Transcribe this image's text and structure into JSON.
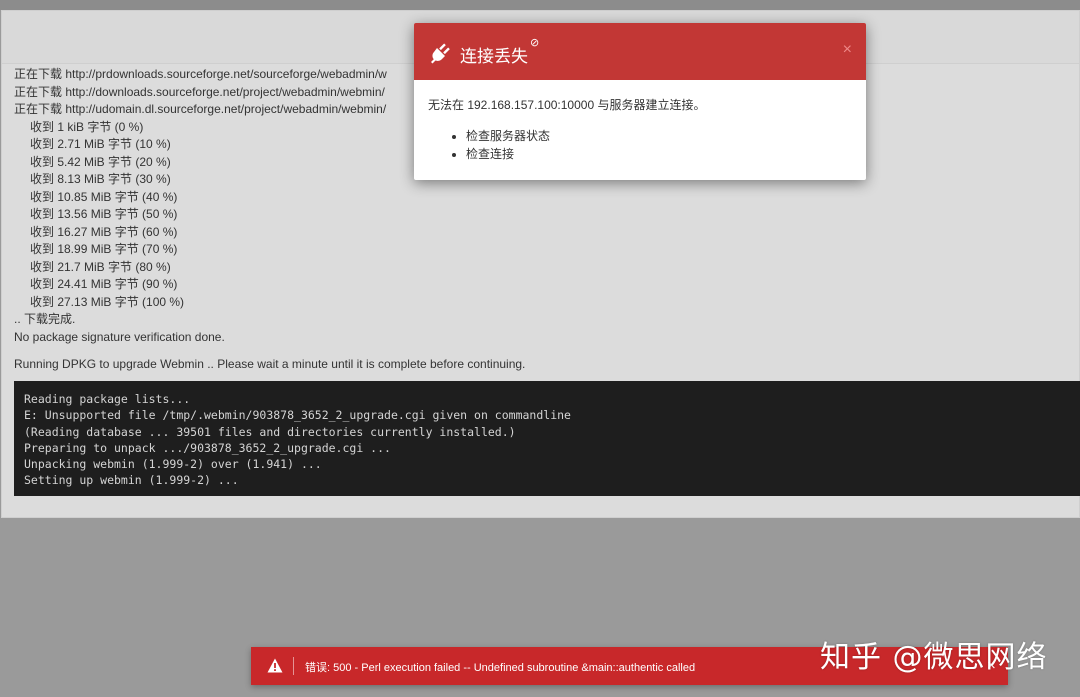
{
  "log": {
    "download_lines": [
      "正在下载 http://prdownloads.sourceforge.net/sourceforge/webadmin/w",
      "正在下载 http://downloads.sourceforge.net/project/webadmin/webmin/",
      "正在下载 http://udomain.dl.sourceforge.net/project/webadmin/webmin/"
    ],
    "progress_lines": [
      "收到 1 kiB 字节 (0 %)",
      "收到 2.71 MiB 字节 (10 %)",
      "收到 5.42 MiB 字节 (20 %)",
      "收到 8.13 MiB 字节 (30 %)",
      "收到 10.85 MiB 字节 (40 %)",
      "收到 13.56 MiB 字节 (50 %)",
      "收到 16.27 MiB 字节 (60 %)",
      "收到 18.99 MiB 字节 (70 %)",
      "收到 21.7 MiB 字节 (80 %)",
      "收到 24.41 MiB 字节 (90 %)",
      "收到 27.13 MiB 字节 (100 %)"
    ],
    "download_complete": ".. 下载完成.",
    "signature": "No package signature verification done.",
    "running": "Running DPKG to upgrade Webmin .. Please wait a minute until it is complete before continuing."
  },
  "terminal": {
    "lines": [
      "Reading package lists...",
      "E: Unsupported file /tmp/.webmin/903878_3652_2_upgrade.cgi given on commandline",
      "(Reading database ... 39501 files and directories currently installed.)",
      "Preparing to unpack .../903878_3652_2_upgrade.cgi ...",
      "Unpacking webmin (1.999-2) over (1.941) ...",
      "Setting up webmin (1.999-2) ..."
    ]
  },
  "modal": {
    "title": "连接丢失",
    "title_icon": "⊘",
    "close": "×",
    "message": "无法在 192.168.157.100:10000 与服务器建立连接。",
    "items": [
      "检查服务器状态",
      "检查连接"
    ]
  },
  "error_bar": {
    "message": "错误: 500 - Perl execution failed -- Undefined subroutine &main::authentic called",
    "close": "×"
  },
  "watermark": "知乎 @微思网络",
  "colors": {
    "modal_header": "#c23735",
    "error_bar": "#c8282a",
    "terminal_bg": "#1e1e1e"
  },
  "icons": {
    "modal": "plug-icon",
    "error": "warning-icon"
  }
}
